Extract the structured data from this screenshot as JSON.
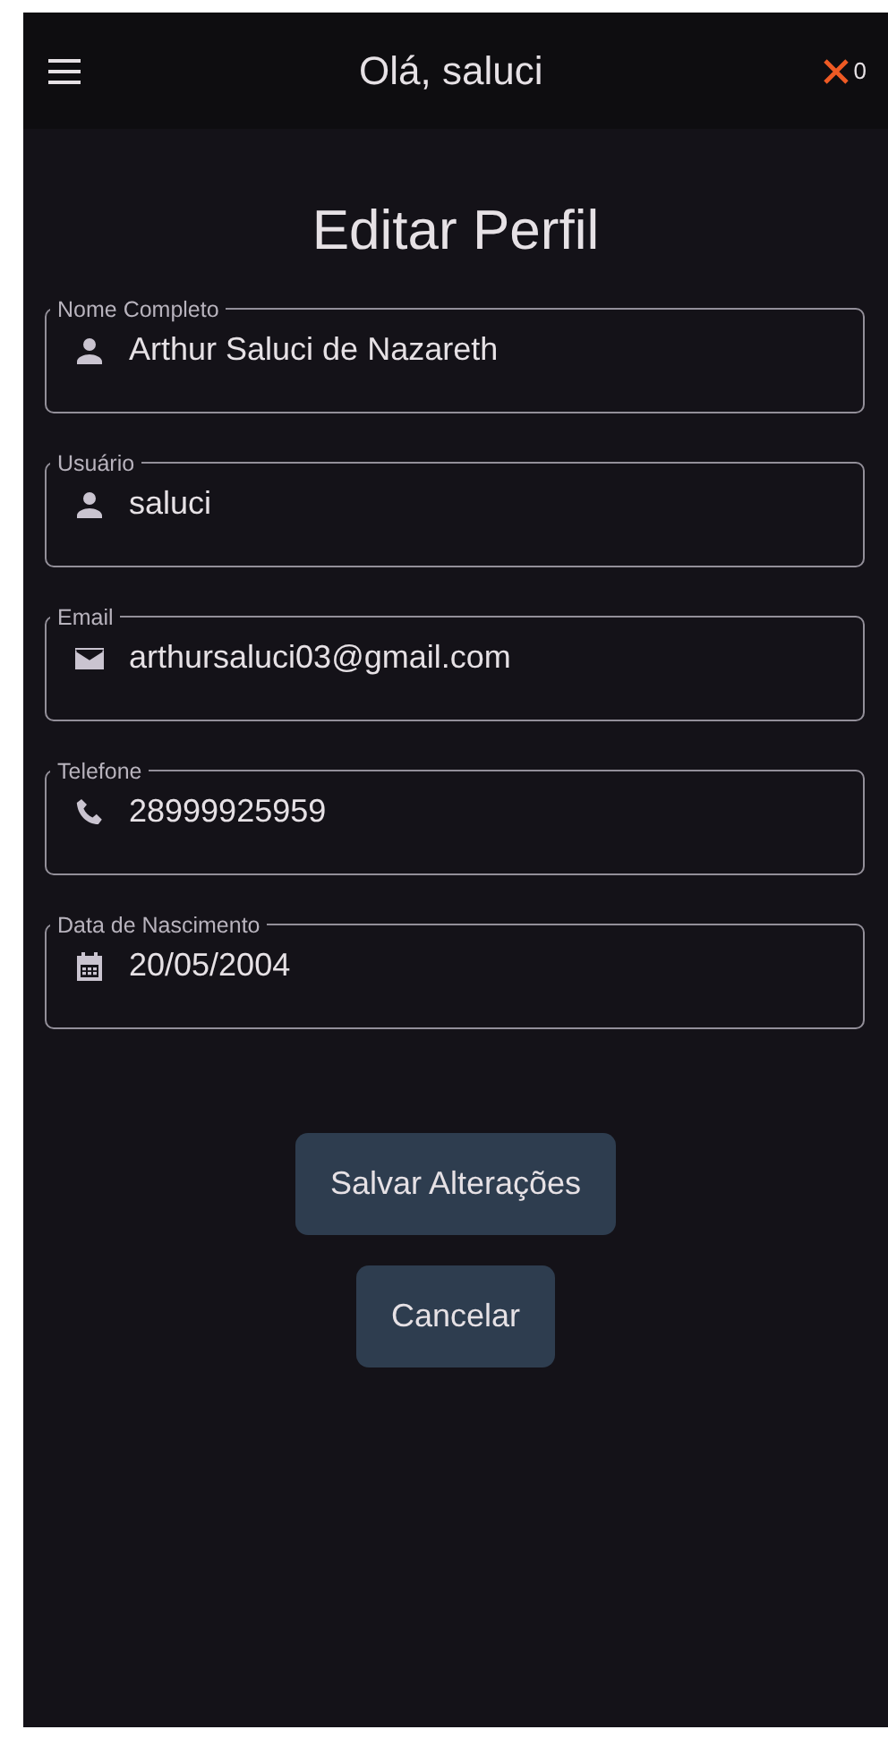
{
  "header": {
    "greeting": "Olá, saluci",
    "close_count": "0"
  },
  "title": "Editar Perfil",
  "fields": [
    {
      "label": "Nome Completo",
      "value": "Arthur Saluci de Nazareth",
      "kind": "person"
    },
    {
      "label": "Usuário",
      "value": "saluci",
      "kind": "person"
    },
    {
      "label": "Email",
      "value": "arthursaluci03@gmail.com",
      "kind": "mail"
    },
    {
      "label": "Telefone",
      "value": "28999925959",
      "kind": "phone"
    },
    {
      "label": "Data de Nascimento",
      "value": "20/05/2004",
      "kind": "calendar"
    }
  ],
  "buttons": [
    "Salvar Alterações",
    "Cancelar"
  ]
}
